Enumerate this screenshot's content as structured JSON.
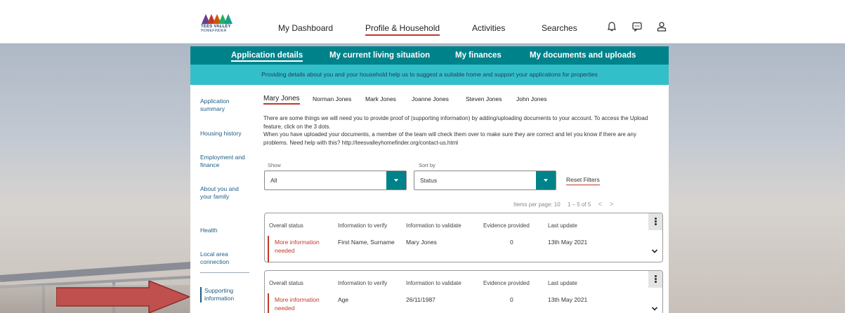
{
  "logo": {
    "line1": "TEES VALLEY",
    "line2": "HOMEFINDER"
  },
  "topnav": {
    "items": [
      "My Dashboard",
      "Profile & Household",
      "Activities",
      "Searches"
    ]
  },
  "subnav": {
    "items": [
      "Application details",
      "My current living situation",
      "My finances",
      "My documents and uploads"
    ]
  },
  "banner": "Providing details about you and your household help us to suggest a suitable home and support your applications for properties",
  "sidebar": {
    "items": [
      "Application summary",
      "Housing history",
      "Employment and finance",
      "About you and your family",
      "Health",
      "Local area connection",
      "Supporting information"
    ]
  },
  "people": [
    "Mary Jones",
    "Norman Jones",
    "Mark Jones",
    "Joanne Jones",
    "Steven Jones",
    "John Jones"
  ],
  "intro": "There are some things we will need you to provide proof of (supporting information) by adding/uploading documents to your account. To access the Upload feature, click on the 3 dots.\nWhen you have uploaded your documents, a member of the team will check them over to make sure they are correct and let you know if there are any problems. Need help with this? http://teesvalleyhomefinder.org/contact-us.html",
  "filters": {
    "show_label": "Show",
    "show_value": "All",
    "sort_label": "Sort by",
    "sort_value": "Status",
    "reset_label": "Reset Filters"
  },
  "pager": {
    "items_per_page": "Items per page: 10",
    "range": "1 – 5 of 5",
    "prev": "<",
    "next": ">"
  },
  "table_headers": [
    "Overall status",
    "Information to verify",
    "Information to validate",
    "Evidence provided",
    "Last update"
  ],
  "records": [
    {
      "status": "More information needed",
      "verify": "First Name, Surname",
      "validate": "Mary Jones",
      "evidence": "0",
      "updated": "13th May 2021"
    },
    {
      "status": "More information needed",
      "verify": "Age",
      "validate": "26/11/1987",
      "evidence": "0",
      "updated": "13th May 2021"
    }
  ],
  "colors": {
    "teal": "#00828a",
    "light_teal": "#33bfca",
    "accent_red": "#c0392b",
    "arrow_red": "#c0504d"
  }
}
